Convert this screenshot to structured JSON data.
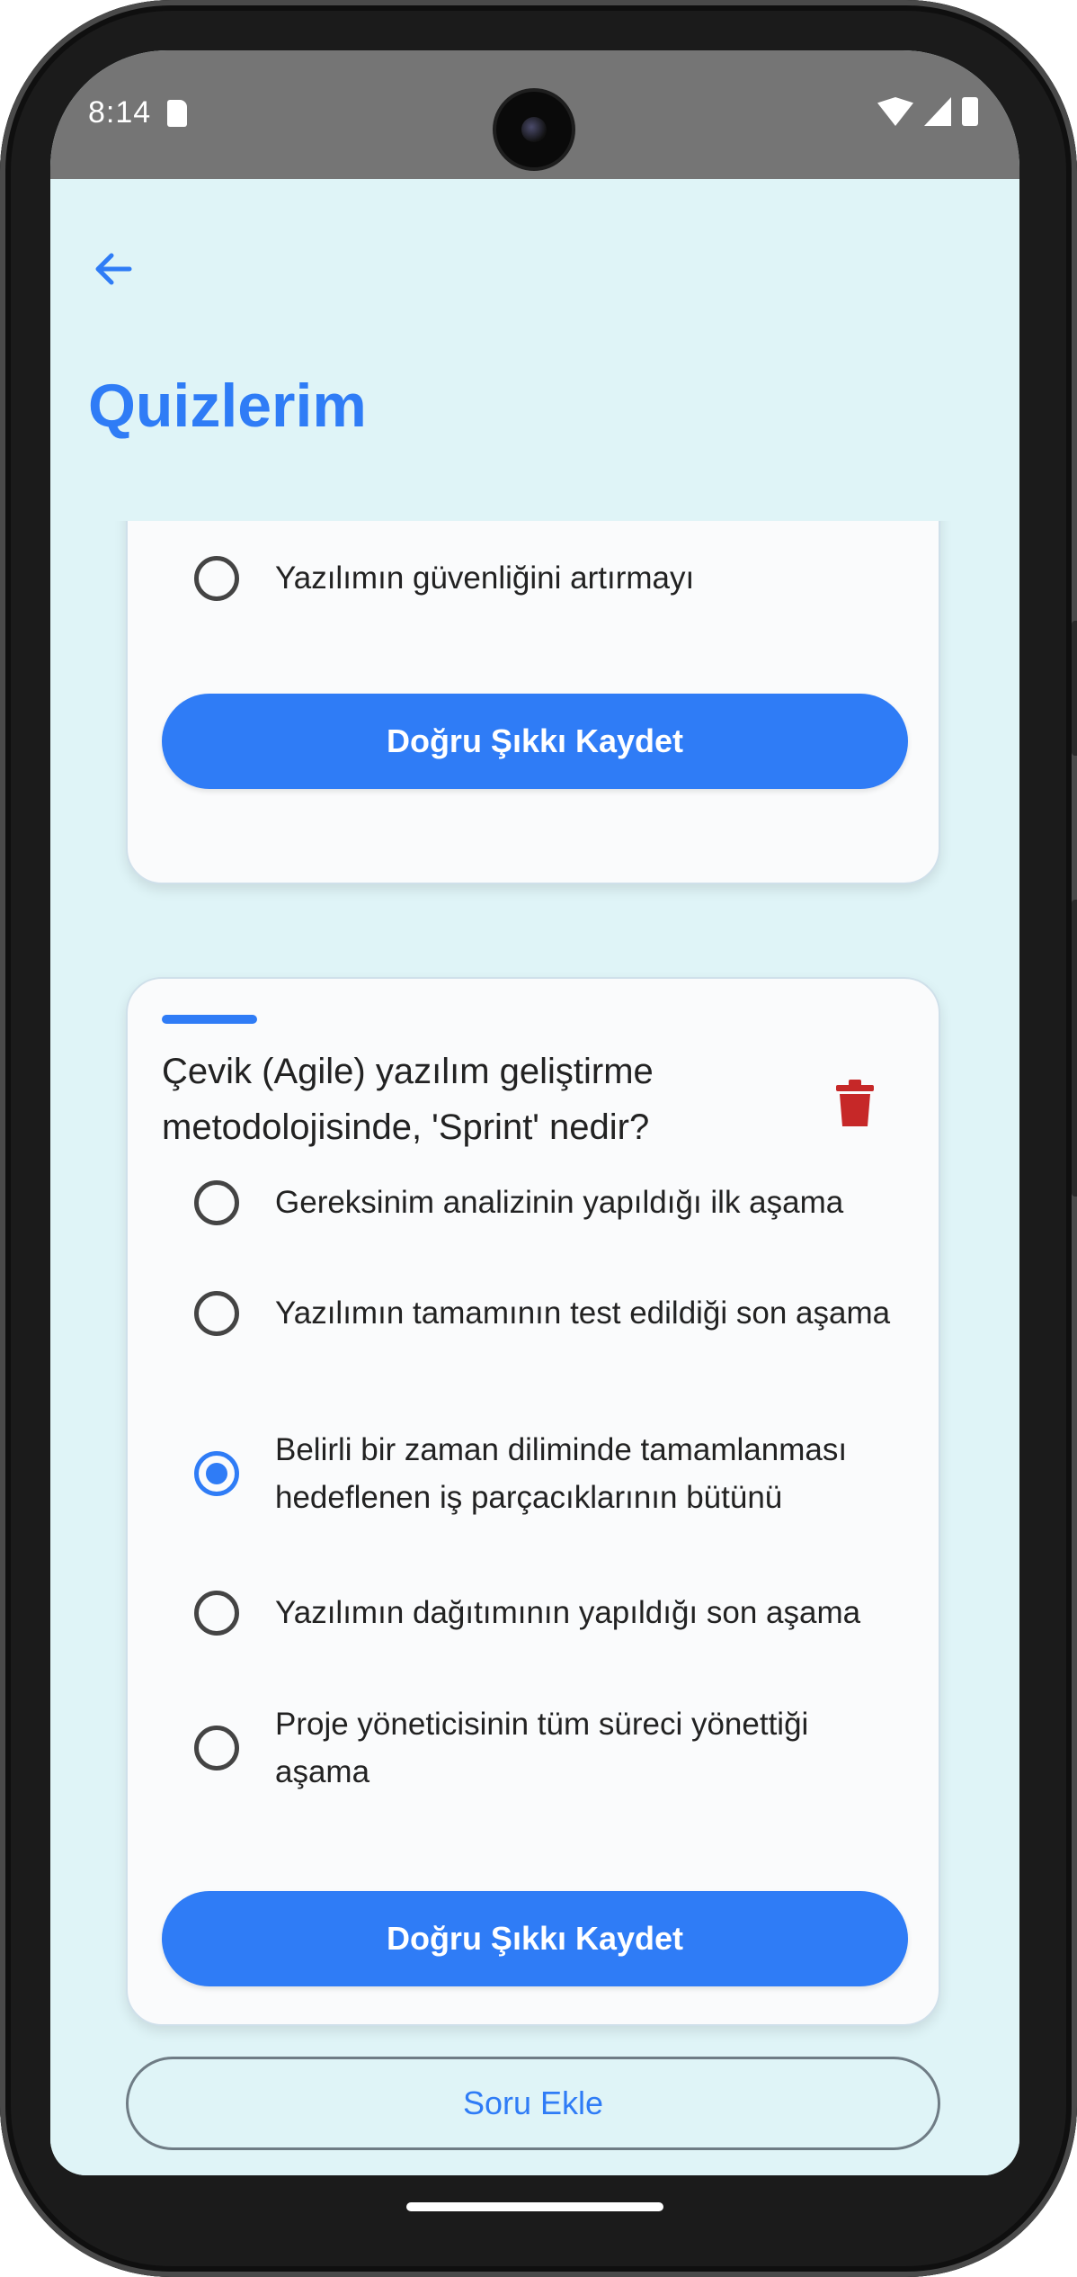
{
  "status_bar": {
    "time": "8:14",
    "icons": [
      "sd-card-icon",
      "wifi-icon",
      "signal-icon",
      "battery-icon"
    ]
  },
  "header": {
    "back_icon": "arrow-left-icon",
    "title": "Quizlerim"
  },
  "colors": {
    "accent": "#2f7cf6",
    "background": "#dff4f7",
    "card": "#fafbfc",
    "delete": "#c62828"
  },
  "cards": [
    {
      "partial": true,
      "options": [
        {
          "label": "Yazılımın güvenliğini artırmayı",
          "selected": false
        }
      ],
      "save_label": "Doğru Şıkkı Kaydet"
    },
    {
      "question": "Çevik (Agile) yazılım geliştirme metodolojisinde, 'Sprint' nedir?",
      "delete_icon": "trash-icon",
      "options": [
        {
          "label": "Gereksinim analizinin yapıldığı ilk aşama",
          "selected": false
        },
        {
          "label": "Yazılımın tamamının test edildiği son aşama",
          "selected": false
        },
        {
          "label": "Belirli bir zaman diliminde tamamlanması hedeflenen iş parçacıklarının bütünü",
          "selected": true
        },
        {
          "label": "Yazılımın dağıtımının yapıldığı son aşama",
          "selected": false
        },
        {
          "label": "Proje yöneticisinin tüm süreci yönettiği aşama",
          "selected": false
        }
      ],
      "save_label": "Doğru Şıkkı Kaydet"
    }
  ],
  "add_question_label": "Soru Ekle"
}
